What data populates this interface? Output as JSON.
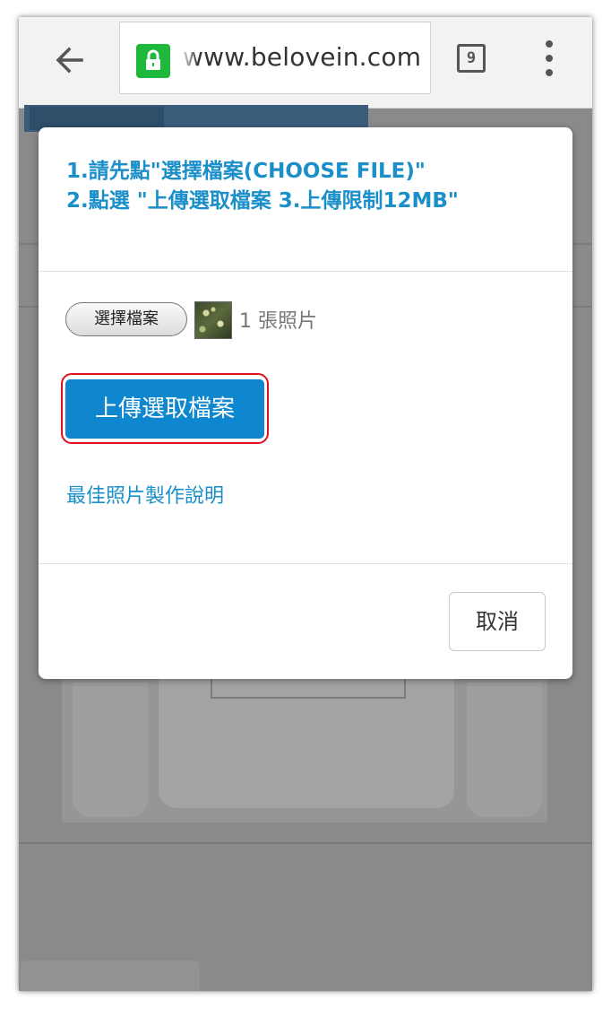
{
  "browser": {
    "url": "www.belovein.com",
    "tab_count": "9"
  },
  "dialog": {
    "instruction_line1": "1.請先點\"選擇檔案(CHOOSE FILE)\"",
    "instruction_line2": "2.點選 \"上傳選取檔案 3.上傳限制12MB\"",
    "choose_file_label": "選擇檔案",
    "file_count": "1 張照片",
    "upload_label": "上傳選取檔案",
    "help_link": "最佳照片製作說明",
    "cancel_label": "取消"
  },
  "icons": {
    "back": "arrow-left-icon",
    "lock": "lock-icon",
    "tabs": "tabs-counter-icon",
    "menu": "more-vertical-icon"
  },
  "colors": {
    "accent": "#1a8fc9",
    "upload_button": "#0f87cf",
    "highlight_outline": "#e01020",
    "lock_green": "#1db83c"
  }
}
